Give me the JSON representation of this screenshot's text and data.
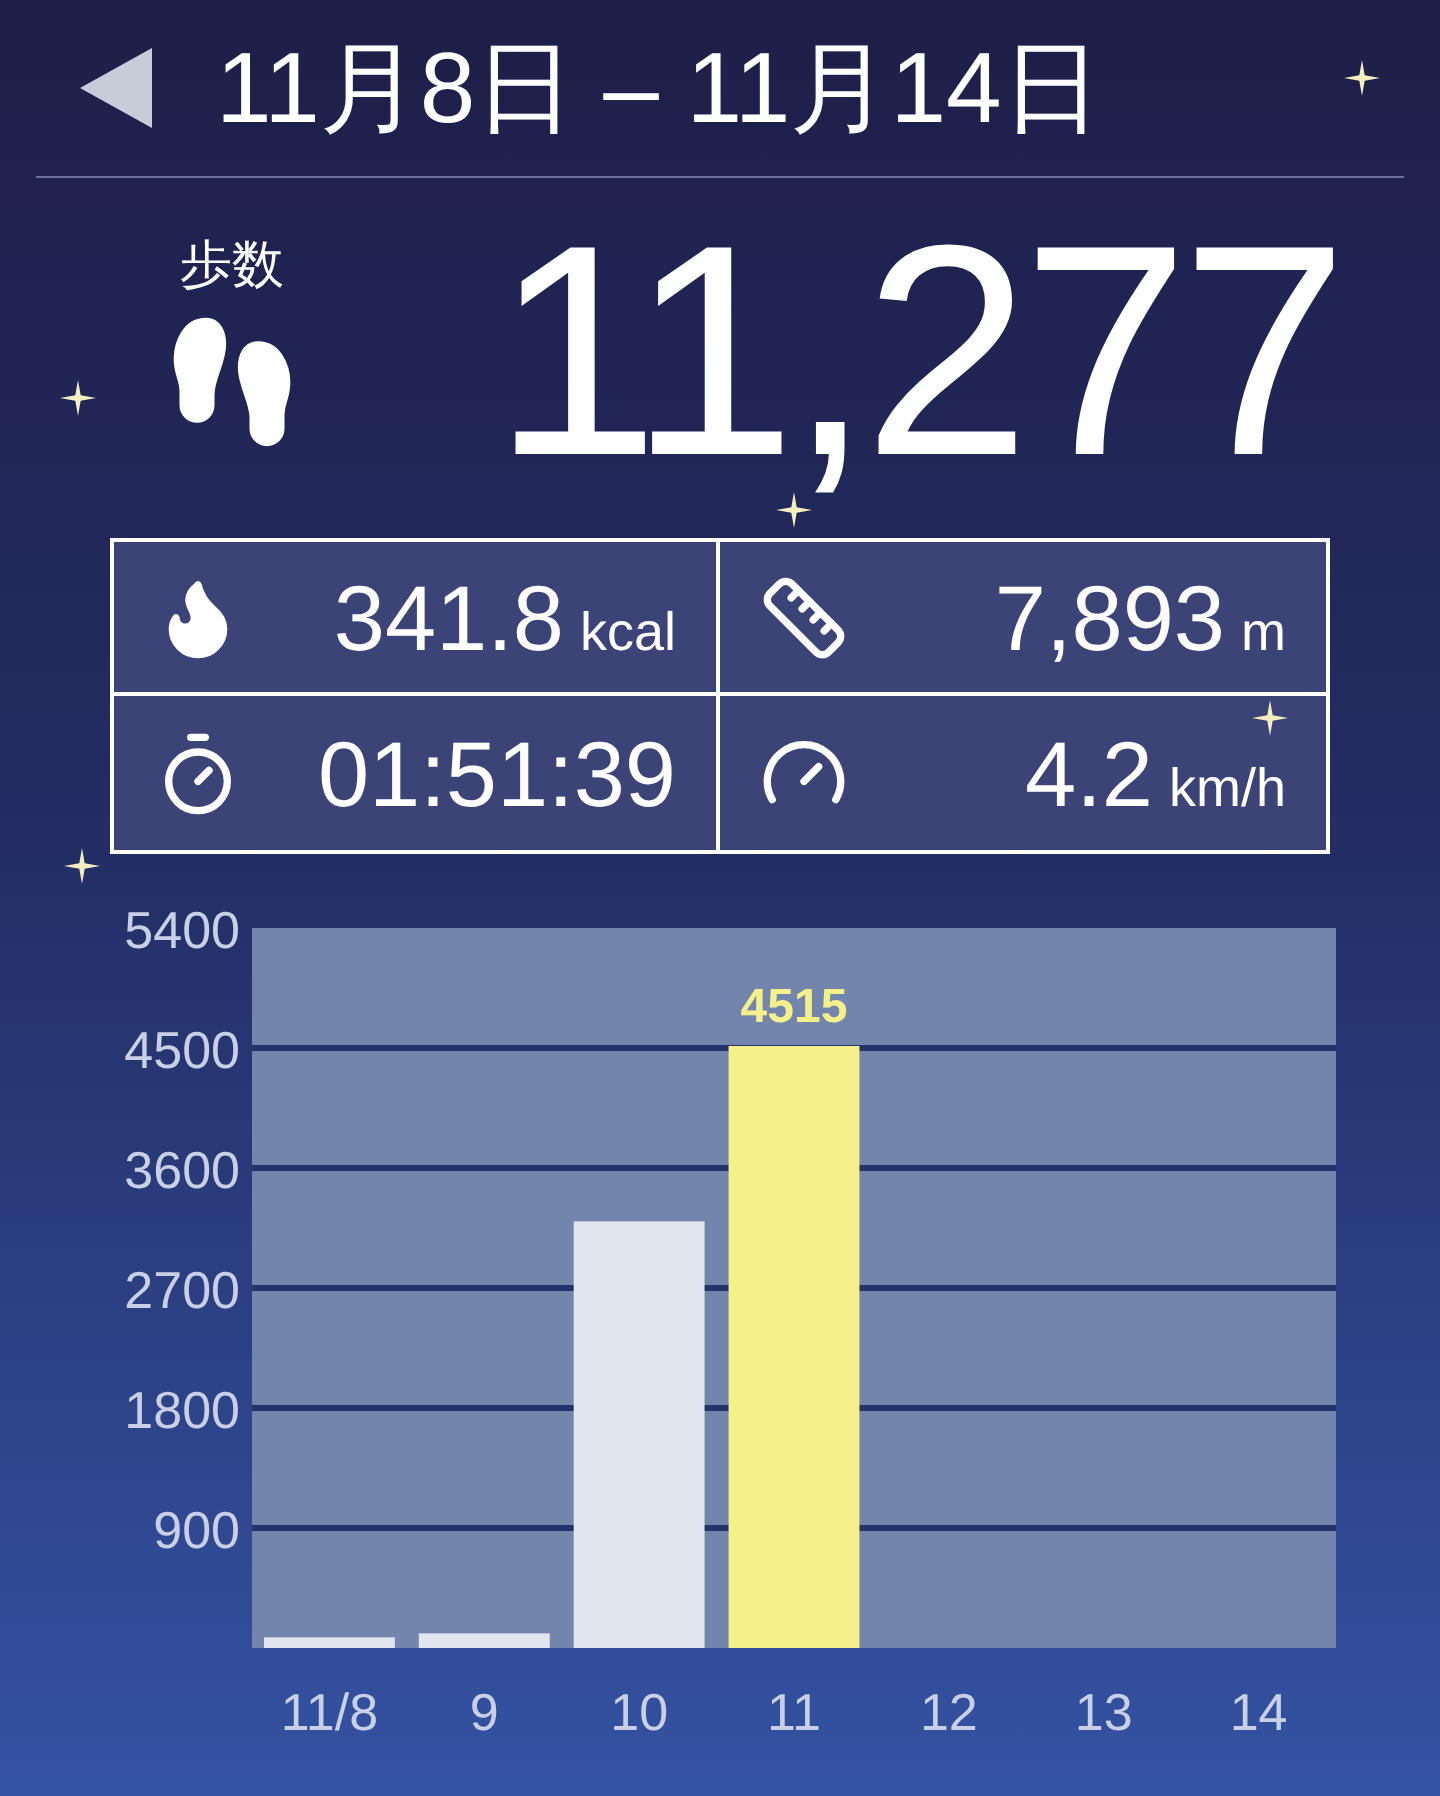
{
  "header": {
    "title": "11月8日 – 11月14日"
  },
  "steps": {
    "label": "歩数",
    "value": "11,277"
  },
  "stats": [
    {
      "kind": "calories",
      "value": "341.8",
      "unit": "kcal"
    },
    {
      "kind": "distance",
      "value": "7,893",
      "unit": "m"
    },
    {
      "kind": "time",
      "value": "01:51:39"
    },
    {
      "kind": "speed",
      "value": "4.2",
      "unit": "km/h"
    }
  ],
  "chart": {
    "chart_data": {
      "type": "bar",
      "categories": [
        "11/8",
        "9",
        "10",
        "11",
        "12",
        "13",
        "14"
      ],
      "series": [
        {
          "values": [
            80,
            110,
            3200,
            4515,
            0,
            0,
            0
          ]
        }
      ],
      "ylim": [
        0,
        5400
      ],
      "yticks": [
        900,
        1800,
        2700,
        3600,
        4500,
        5400
      ],
      "grid": true,
      "annotations": [
        {
          "x": "11",
          "y": 4515,
          "text": "4515"
        }
      ]
    }
  }
}
